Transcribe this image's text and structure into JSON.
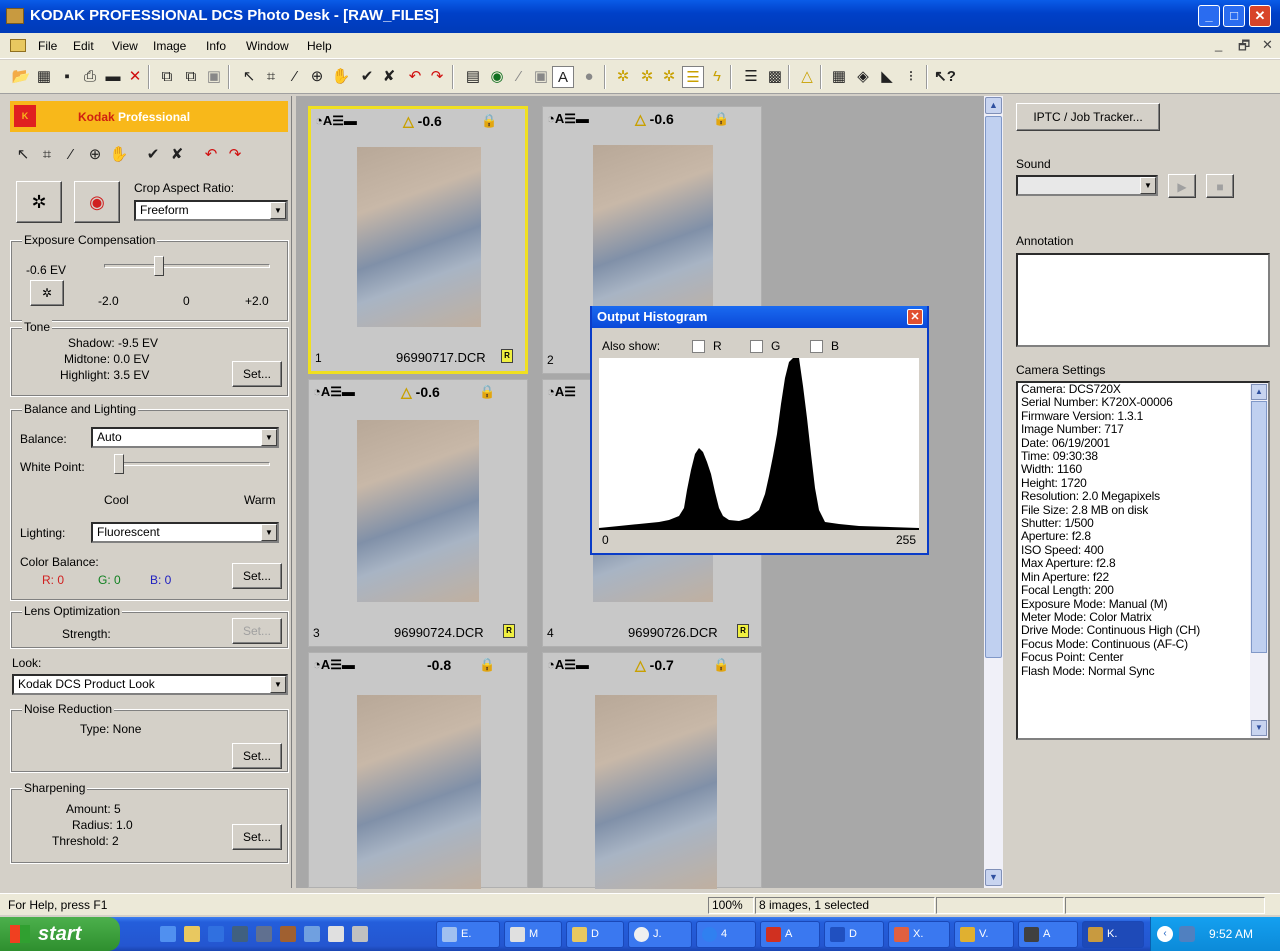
{
  "window": {
    "title": "KODAK PROFESSIONAL DCS Photo Desk - [RAW_FILES]",
    "min": "_",
    "max": "□",
    "close": "✕"
  },
  "menu": [
    "File",
    "Edit",
    "View",
    "Image",
    "Info",
    "Window",
    "Help"
  ],
  "mdi": {
    "min": "_",
    "restore": "🗗",
    "close": "✕"
  },
  "left": {
    "logo_kodak": "Kodak",
    "logo_pro": "Professional",
    "crop_label": "Crop Aspect Ratio:",
    "crop_value": "Freeform",
    "exposure": {
      "title": "Exposure Compensation",
      "value": "-0.6 EV",
      "min": "-2.0",
      "mid": "0",
      "max": "+2.0",
      "level": -0.6
    },
    "tone": {
      "title": "Tone",
      "shadow": "Shadow:  -9.5 EV",
      "midtone": "Midtone:  0.0 EV",
      "highlight": "Highlight:  3.5 EV",
      "set": "Set..."
    },
    "balance": {
      "title": "Balance and Lighting",
      "balance_label": "Balance:",
      "balance_value": "Auto",
      "wp_label": "White Point:",
      "cool": "Cool",
      "warm": "Warm",
      "lighting_label": "Lighting:",
      "lighting_value": "Fluorescent",
      "cb_label": "Color Balance:",
      "r": "R:  0",
      "g": "G:  0",
      "b": "B:  0",
      "set": "Set..."
    },
    "lens": {
      "title": "Lens Optimization",
      "strength": "Strength:",
      "set": "Set..."
    },
    "look": {
      "label": "Look:",
      "value": "Kodak DCS Product Look"
    },
    "noise": {
      "title": "Noise Reduction",
      "type": "Type:  None",
      "set": "Set..."
    },
    "sharpen": {
      "title": "Sharpening",
      "amount": "Amount:  5",
      "radius": "Radius:  1.0",
      "threshold": "Threshold:  2",
      "set": "Set..."
    }
  },
  "thumbs": [
    {
      "num": "1",
      "name": "96990717.DCR",
      "ev": "-0.6",
      "warn": true,
      "sel": true
    },
    {
      "num": "2",
      "name": "",
      "ev": "-0.6",
      "warn": true,
      "sel": false
    },
    {
      "num": "3",
      "name": "96990724.DCR",
      "ev": "-0.6",
      "warn": true,
      "sel": false
    },
    {
      "num": "4",
      "name": "96990726.DCR",
      "ev": "",
      "warn": false,
      "sel": false
    },
    {
      "num": "",
      "name": "",
      "ev": "-0.8",
      "warn": false,
      "sel": false
    },
    {
      "num": "",
      "name": "",
      "ev": "-0.7",
      "warn": true,
      "sel": false
    }
  ],
  "histogram": {
    "title": "Output Histogram",
    "also": "Also show:",
    "r": "R",
    "g": "G",
    "b": "B",
    "min": "0",
    "max": "255"
  },
  "right": {
    "iptc": "IPTC / Job Tracker...",
    "sound": "Sound",
    "annotation": "Annotation",
    "camera_title": "Camera Settings",
    "camera": [
      "Camera:  DCS720X",
      "Serial Number:  K720X-00006",
      "Firmware Version:  1.3.1",
      "Image Number:  717",
      "Date:  06/19/2001",
      "Time:  09:30:38",
      "Width:  1160",
      "Height:  1720",
      "Resolution: 2.0 Megapixels",
      "File Size: 2.8 MB on disk",
      "Shutter:  1/500",
      "Aperture:  f2.8",
      "ISO Speed:  400",
      "Max Aperture:  f2.8",
      "Min Aperture:  f22",
      "Focal Length:  200",
      "Exposure Mode:  Manual (M)",
      "Meter Mode:  Color Matrix",
      "Drive Mode:  Continuous High (CH)",
      "Focus Mode:  Continuous (AF-C)",
      "Focus Point:  Center",
      "Flash Mode:  Normal Sync"
    ]
  },
  "status": {
    "help": "For Help, press F1",
    "zoom": "100%",
    "count": "8 images,  1 selected"
  },
  "taskbar": {
    "start": "start",
    "items": [
      "E.",
      "M",
      "D",
      "J.",
      "4",
      "A",
      "D",
      "X.",
      "V.",
      "A",
      "K."
    ],
    "time": "9:52 AM"
  }
}
